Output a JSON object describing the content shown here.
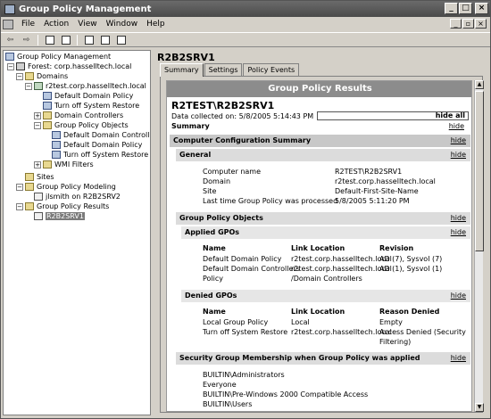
{
  "window": {
    "title": "Group Policy Management"
  },
  "menu": [
    "File",
    "Action",
    "View",
    "Window",
    "Help"
  ],
  "tree": {
    "root": "Group Policy Management",
    "forest": "Forest: corp.hasselltech.local",
    "domains": "Domains",
    "domain": "r2test.corp.hasselltech.local",
    "domain_children": [
      "Default Domain Policy",
      "Turn off System Restore",
      "Domain Controllers",
      "Group Policy Objects"
    ],
    "gpo_children": [
      "Default Domain Controlle",
      "Default Domain Policy",
      "Turn off System Restore"
    ],
    "wmi": "WMI Filters",
    "sites": "Sites",
    "modeling": "Group Policy Modeling",
    "modeling_child": "jlsmith on R2B2SRV2",
    "results": "Group Policy Results",
    "results_child": "R2B2SRV1"
  },
  "right": {
    "title": "R2B2SRV1",
    "tabs": [
      "Summary",
      "Settings",
      "Policy Events"
    ]
  },
  "report": {
    "header": "Group Policy Results",
    "title": "R2TEST\\R2B2SRV1",
    "collected": "Data collected on: 5/8/2005 5:14:43 PM",
    "hide_all": "hide all",
    "summary": "Summary",
    "hide": "hide",
    "computer_config": "Computer Configuration Summary",
    "general": "General",
    "general_rows": [
      {
        "k": "Computer name",
        "v": "R2TEST\\R2B2SRV1"
      },
      {
        "k": "Domain",
        "v": "r2test.corp.hasselltech.local"
      },
      {
        "k": "Site",
        "v": "Default-First-Site-Name"
      },
      {
        "k": "Last time Group Policy was processed",
        "v": "5/8/2005 5:11:20 PM"
      }
    ],
    "gpo_section": "Group Policy Objects",
    "applied": "Applied GPOs",
    "applied_cols": [
      "Name",
      "Link Location",
      "Revision"
    ],
    "applied_rows": [
      [
        "Default Domain Policy",
        "r2test.corp.hasselltech.local",
        "AD (7), Sysvol (7)"
      ],
      [
        "Default Domain Controllers",
        "r2test.corp.hasselltech.local",
        "AD (1), Sysvol (1)"
      ],
      [
        "Policy",
        "/Domain Controllers",
        ""
      ]
    ],
    "denied": "Denied GPOs",
    "denied_cols": [
      "Name",
      "Link Location",
      "Reason Denied"
    ],
    "denied_rows": [
      [
        "Local Group Policy",
        "Local",
        "Empty"
      ],
      [
        "Turn off System Restore",
        "r2test.corp.hasselltech.local",
        "Access Denied (Security"
      ],
      [
        "",
        "",
        "Filtering)"
      ]
    ],
    "security": "Security Group Membership when Group Policy was applied",
    "groups": [
      "BUILTIN\\Administrators",
      "Everyone",
      "BUILTIN\\Pre-Windows 2000 Compatible Access",
      "BUILTIN\\Users"
    ]
  }
}
